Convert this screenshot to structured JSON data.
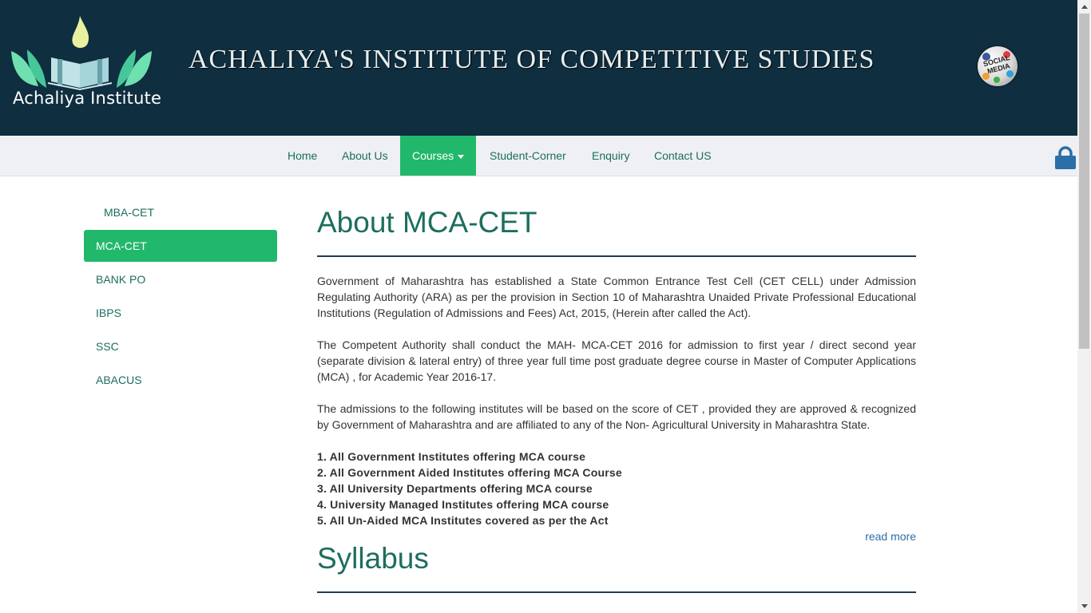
{
  "header": {
    "logo_text": "Achaliya Institute",
    "site_title": "Achaliya's Institute of Competitive Studies",
    "social_label": "SOCIAL MEDIA"
  },
  "nav": {
    "items": [
      {
        "label": "Home"
      },
      {
        "label": "About Us"
      },
      {
        "label": "Courses"
      },
      {
        "label": "Student-Corner"
      },
      {
        "label": "Enquiry"
      },
      {
        "label": "Contact US"
      }
    ]
  },
  "sidebar": {
    "items": [
      {
        "label": "MBA-CET"
      },
      {
        "label": "MCA-CET"
      },
      {
        "label": "BANK PO"
      },
      {
        "label": "IBPS"
      },
      {
        "label": "SSC"
      },
      {
        "label": "ABACUS"
      }
    ]
  },
  "main": {
    "title": "About MCA-CET",
    "paragraphs": [
      "Government of Maharashtra has established a State Common Entrance Test Cell (CET CELL) under Admission Regulating Authority (ARA) as per the provision in Section 10 of Maharashtra Unaided Private Professional Educational Institutions (Regulation of Admissions and Fees) Act, 2015, (Herein after called the Act).",
      "The Competent Authority shall conduct the MAH- MCA-CET 2016 for admission to first year / direct second year (separate division & lateral entry) of three year full time post graduate degree course in Master of Computer Applications (MCA) , for Academic Year 2016-17.",
      "The admissions to the following institutes will be based on the score of CET , provided they are approved & recognized by Government of Maharashtra and are affiliated to any of the Non- Agricultural University in Maharashtra State."
    ],
    "list": [
      "1. All Government Institutes offering MCA course",
      "2. All Government Aided Institutes offering MCA Course",
      "3. All University Departments offering MCA course",
      "4. University Managed Institutes offering MCA course",
      "5. All Un-Aided MCA Institutes covered as per the Act"
    ],
    "read_more": "read more",
    "syllabus_title": "Syllabus"
  },
  "colors": {
    "header_bg": "#0f2e3f",
    "accent_green": "#22b86b",
    "link_teal": "#1d6e5e",
    "navbar_bg": "#eff0f3"
  }
}
